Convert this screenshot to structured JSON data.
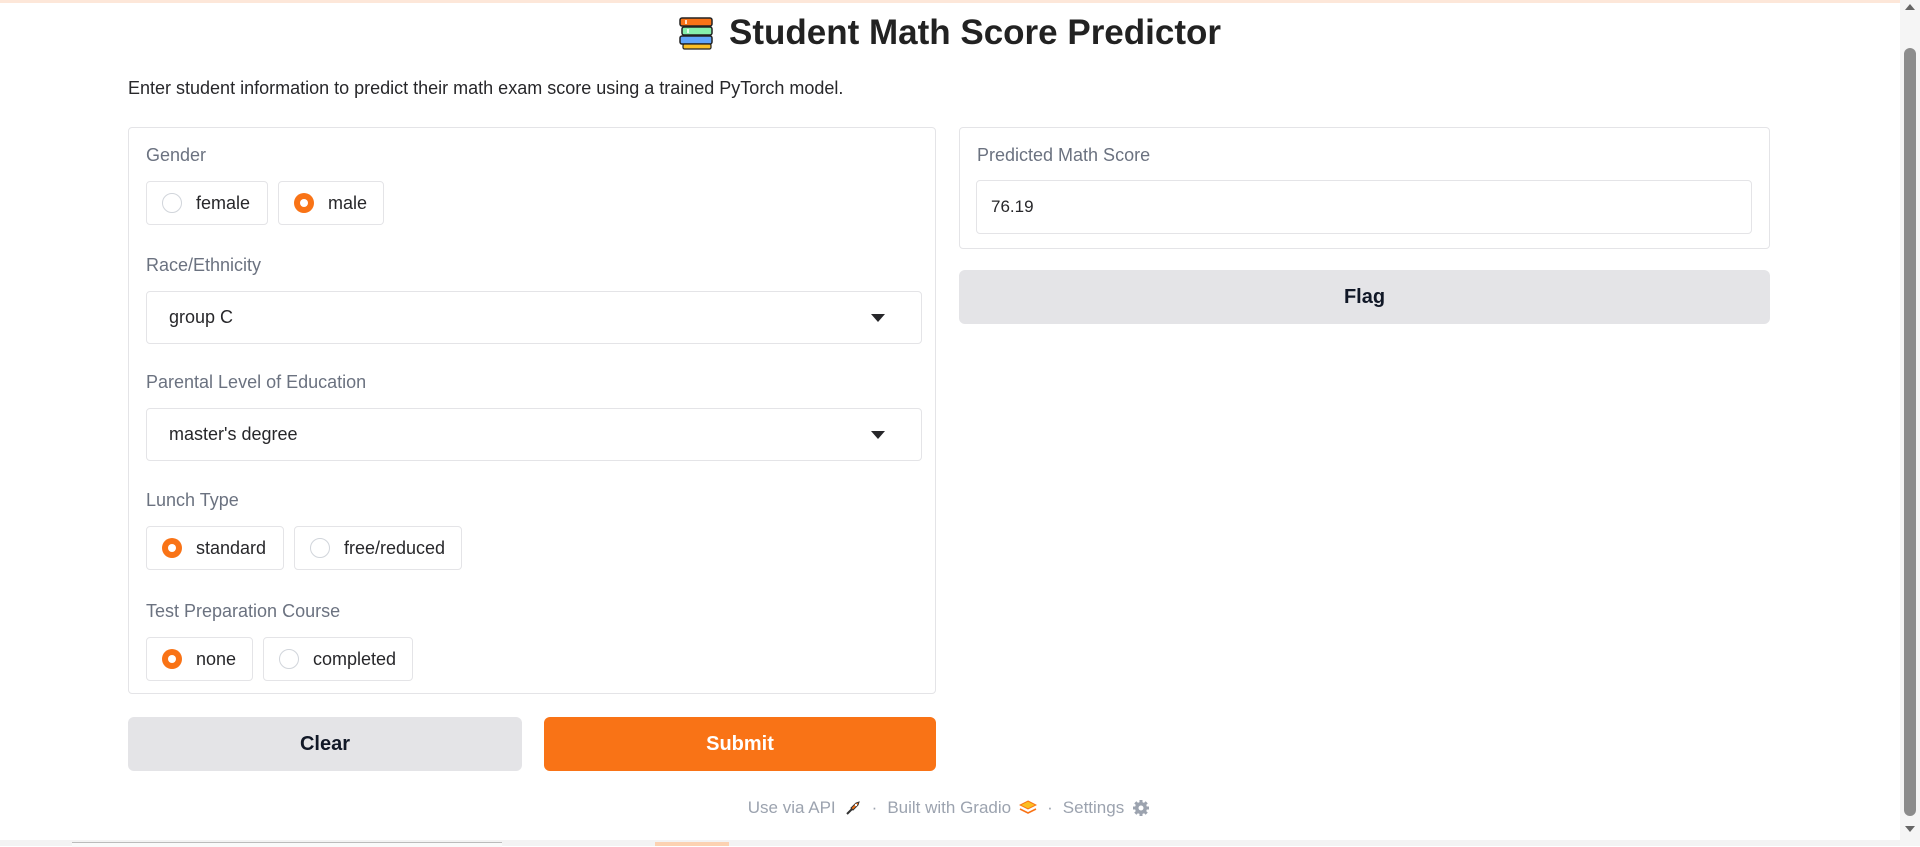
{
  "header": {
    "title": "Student Math Score Predictor",
    "icon": "books-icon",
    "description": "Enter student information to predict their math exam score using a trained PyTorch model."
  },
  "inputs": {
    "gender": {
      "label": "Gender",
      "options": [
        "female",
        "male"
      ],
      "selected": "male"
    },
    "race": {
      "label": "Race/Ethnicity",
      "value": "group C"
    },
    "parental_education": {
      "label": "Parental Level of Education",
      "value": "master's degree"
    },
    "lunch": {
      "label": "Lunch Type",
      "options": [
        "standard",
        "free/reduced"
      ],
      "selected": "standard"
    },
    "test_prep": {
      "label": "Test Preparation Course",
      "options": [
        "none",
        "completed"
      ],
      "selected": "none"
    }
  },
  "output": {
    "label": "Predicted Math Score",
    "value": "76.19"
  },
  "buttons": {
    "flag": "Flag",
    "clear": "Clear",
    "submit": "Submit"
  },
  "footer": {
    "api": "Use via API",
    "built": "Built with Gradio",
    "settings": "Settings",
    "separator": "·"
  },
  "colors": {
    "accent": "#f97316",
    "button_gray": "#e4e4e7",
    "border": "#e4e4e7"
  }
}
